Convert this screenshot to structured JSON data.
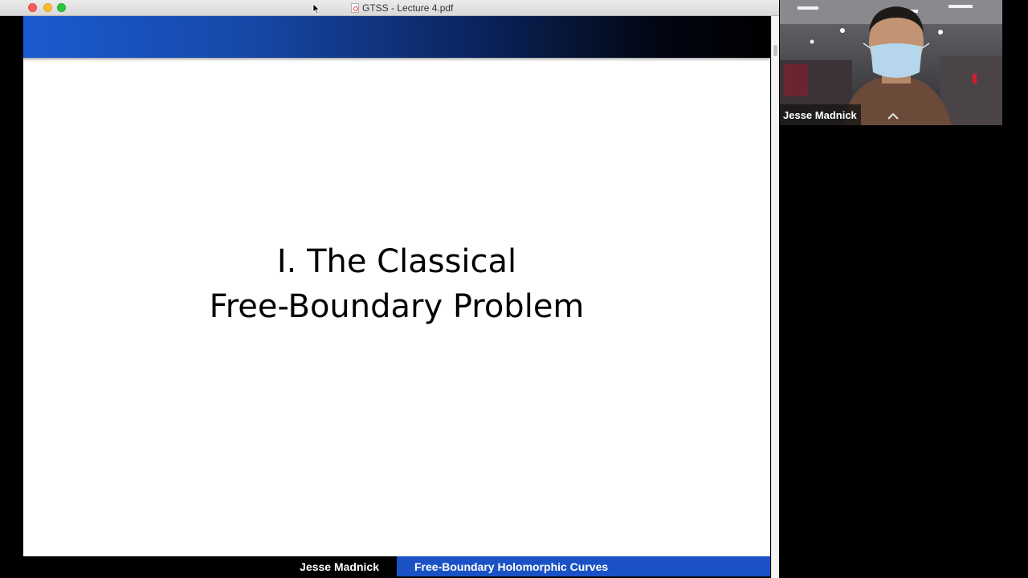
{
  "window": {
    "title": "GTSS - Lecture 4.pdf",
    "file_icon": "pdf-file-icon"
  },
  "slide": {
    "title_line_1": "I. The Classical",
    "title_line_2": "Free-Boundary Problem",
    "footer_author": "Jesse Madnick",
    "footer_talk_title": "Free-Boundary Holomorphic Curves",
    "colors": {
      "header_blue": "#1a5bd0",
      "footer_blue": "#1a52c6",
      "footer_black": "#000000"
    }
  },
  "video": {
    "participant_name": "Jesse Madnick"
  },
  "icons": [
    "close-window-icon",
    "minimize-window-icon",
    "maximize-window-icon",
    "pdf-file-icon",
    "mouse-cursor-icon"
  ]
}
